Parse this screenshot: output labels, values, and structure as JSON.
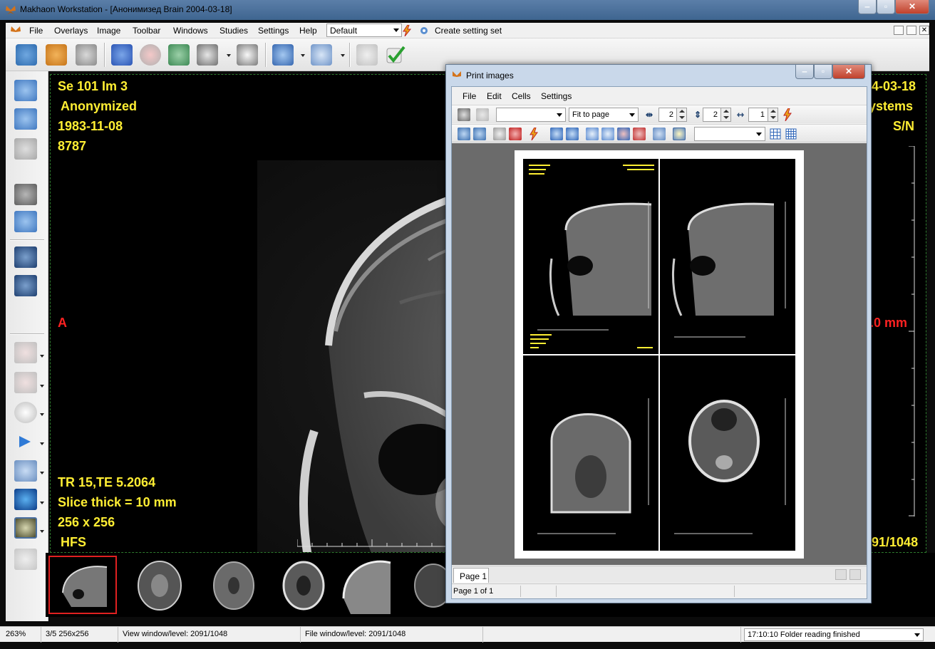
{
  "window": {
    "title": "Makhaon Workstation - [Анонимизед Brain 2004-03-18]"
  },
  "menu": {
    "items": [
      "File",
      "Overlays",
      "Image",
      "Toolbar",
      "Windows",
      "Studies",
      "Settings",
      "Help"
    ],
    "preset": "Default",
    "create_setting_set": "Create setting set"
  },
  "overlay": {
    "top_left": [
      "Se 101 Im 3",
      "Anonymized",
      "1983-11-08",
      "8787"
    ],
    "orientation_left": "A",
    "bottom_left": [
      "TR 15,TE 5.2064",
      "Slice thick = 10 mm",
      "256 x 256",
      "HFS"
    ],
    "top_right_date": "4-03-18",
    "top_right_vendor": "ystems",
    "top_right_sn": "S/N",
    "right_scale": ".0 mm",
    "bottom_right_wl": "091/1048"
  },
  "print_dialog": {
    "title": "Print images",
    "menu": [
      "File",
      "Edit",
      "Cells",
      "Settings"
    ],
    "fit_mode": "Fit to page",
    "columns": "2",
    "rows": "2",
    "copies": "1",
    "tab_label": "Page 1",
    "status": "Page 1 of 1"
  },
  "statusbar": {
    "zoom": "263%",
    "image_info": "3/5 256x256",
    "view_window_level": "View window/level: 2091/1048",
    "file_window_level": "File window/level: 2091/1048",
    "message": "17:10:10 Folder reading finished"
  },
  "colors": {
    "overlay_yellow": "#ffee33",
    "overlay_red": "#ff2222",
    "selection_border": "#e02020"
  }
}
